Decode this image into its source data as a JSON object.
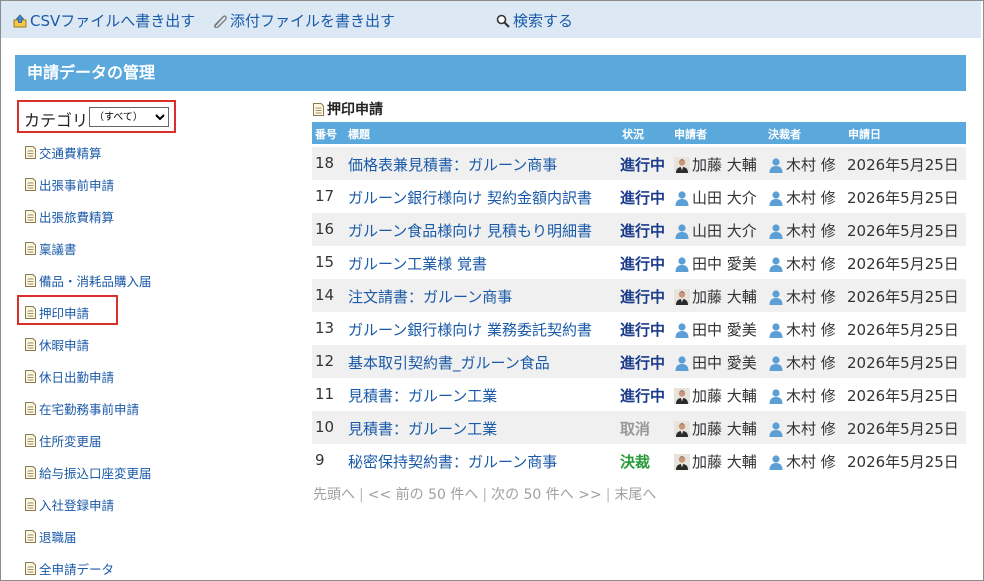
{
  "toolbar": {
    "csv_export": "CSVファイルへ書き出す",
    "attach_export": "添付ファイルを書き出す",
    "search": "検索する"
  },
  "panel": {
    "title": "申請データの管理"
  },
  "category": {
    "label": "カテゴリ",
    "selected": "（すべて）"
  },
  "categories": [
    "交通費精算",
    "出張事前申請",
    "出張旅費精算",
    "稟議書",
    "備品・消耗品購入届",
    "押印申請",
    "休暇申請",
    "休日出勤申請",
    "在宅勤務事前申請",
    "住所変更届",
    "給与振込口座変更届",
    "入社登録申請",
    "退職届",
    "全申請データ"
  ],
  "list": {
    "title": "押印申請",
    "columns": {
      "num": "番号",
      "title": "標題",
      "status": "状況",
      "applicant": "申請者",
      "approver": "決裁者",
      "date": "申請日"
    },
    "rows": [
      {
        "num": "18",
        "title": "価格表兼見積書：ガルーン商事",
        "status": "進行中",
        "applicant": "加藤 大輔",
        "approver": "木村 修",
        "date": "2026年5月25日"
      },
      {
        "num": "17",
        "title": "ガルーン銀行様向け 契約金額内訳書",
        "status": "進行中",
        "applicant": "山田 大介",
        "approver": "木村 修",
        "date": "2026年5月25日"
      },
      {
        "num": "16",
        "title": "ガルーン食品様向け 見積もり明細書",
        "status": "進行中",
        "applicant": "山田 大介",
        "approver": "木村 修",
        "date": "2026年5月25日"
      },
      {
        "num": "15",
        "title": "ガルーン工業様 覚書",
        "status": "進行中",
        "applicant": "田中 愛美",
        "approver": "木村 修",
        "date": "2026年5月25日"
      },
      {
        "num": "14",
        "title": "注文請書：ガルーン商事",
        "status": "進行中",
        "applicant": "加藤 大輔",
        "approver": "木村 修",
        "date": "2026年5月25日"
      },
      {
        "num": "13",
        "title": "ガルーン銀行様向け 業務委託契約書",
        "status": "進行中",
        "applicant": "田中 愛美",
        "approver": "木村 修",
        "date": "2026年5月25日"
      },
      {
        "num": "12",
        "title": "基本取引契約書_ガルーン食品",
        "status": "進行中",
        "applicant": "田中 愛美",
        "approver": "木村 修",
        "date": "2026年5月25日"
      },
      {
        "num": "11",
        "title": "見積書：ガルーン工業",
        "status": "進行中",
        "applicant": "加藤 大輔",
        "approver": "木村 修",
        "date": "2026年5月25日"
      },
      {
        "num": "10",
        "title": "見積書：ガルーン工業",
        "status": "取消",
        "applicant": "加藤 大輔",
        "approver": "木村 修",
        "date": "2026年5月25日"
      },
      {
        "num": "9",
        "title": "秘密保持契約書：ガルーン商事",
        "status": "決裁",
        "applicant": "加藤 大輔",
        "approver": "木村 修",
        "date": "2026年5月25日"
      }
    ]
  },
  "pager": {
    "first": "先頭へ",
    "prev": "<< 前の 50 件へ",
    "next": "次の 50 件へ >>",
    "last": "末尾へ"
  },
  "colors": {
    "header_bg": "#5aa8dc",
    "toolbar_bg": "#dce8f4",
    "link": "#1a5aa8",
    "status_in_progress": "#1a3a8a",
    "status_cancelled": "#999999",
    "status_approved": "#2a9a3a",
    "highlight_box": "#d9302a"
  }
}
